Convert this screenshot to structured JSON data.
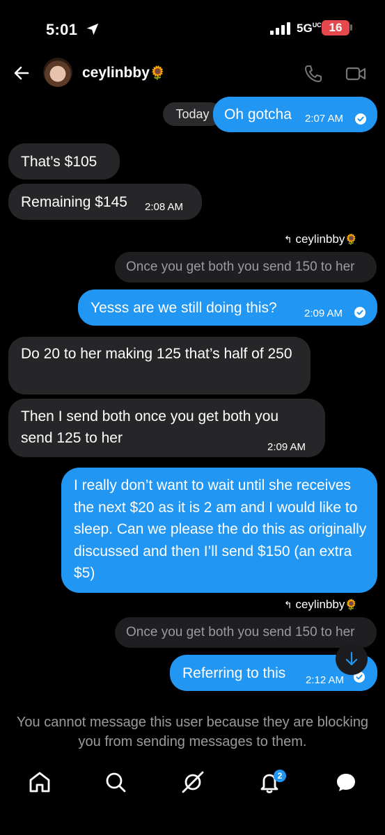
{
  "status_bar": {
    "time": "5:01",
    "network": "5G",
    "network_sup": "UC",
    "battery": "16"
  },
  "header": {
    "username": "ceylinbby",
    "username_emoji": "🌻"
  },
  "conversation": {
    "today_label": "Today",
    "messages": [
      {
        "side": "right",
        "text": "Oh gotcha",
        "time": "2:07 AM",
        "read": true
      },
      {
        "side": "left",
        "text": "That’s $105"
      },
      {
        "side": "left",
        "text": "Remaining $145",
        "time": "2:08 AM"
      },
      {
        "side": "right",
        "reply_to": "ceylinbby",
        "reply_emoji": "🌻",
        "quoted": "Once you get both you send 150 to her",
        "text": "Yesss are we still doing this?",
        "time": "2:09 AM",
        "read": true
      },
      {
        "side": "left",
        "text": "Do 20 to her making 125 that’s half of 250"
      },
      {
        "side": "left",
        "text": "Then I send both once you get both you send 125 to her",
        "time": "2:09 AM"
      },
      {
        "side": "right",
        "text": "I really don’t want to wait until she receives the next $20 as it is 2 am and I would like to sleep. Can we please the do this as originally discussed and then I’ll send $150 (an extra $5)"
      },
      {
        "side": "right",
        "reply_to": "ceylinbby",
        "reply_emoji": "🌻",
        "quoted": "Once you get both you send 150 to her",
        "text": "Referring to this",
        "time": "2:12 AM",
        "read": true
      }
    ]
  },
  "notice": "You cannot message this user because they are blocking you from sending messages to them.",
  "bottom_nav": {
    "notifications_badge": "2"
  },
  "colors": {
    "accent": "#2196f3",
    "bubble_gray": "#262629",
    "background": "#000000"
  }
}
